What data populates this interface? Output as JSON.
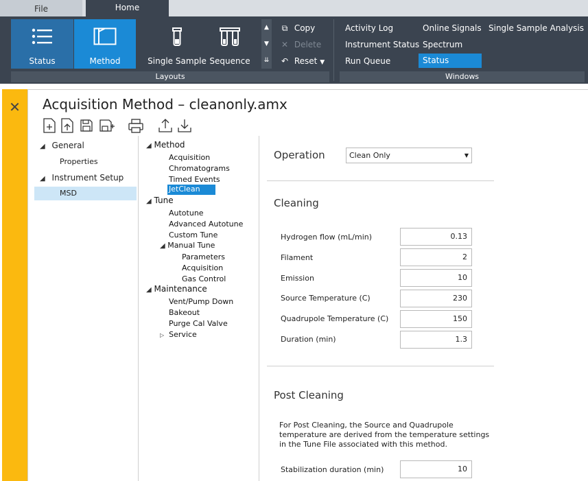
{
  "tabs": {
    "file": "File",
    "home": "Home"
  },
  "ribbon": {
    "status": "Status",
    "method": "Method",
    "single_sample": "Single Sample",
    "sequence": "Sequence",
    "copy": "Copy",
    "delete": "Delete",
    "reset": "Reset",
    "group_layouts": "Layouts",
    "group_windows": "Windows",
    "windows": {
      "activity_log": "Activity Log",
      "instrument_status": "Instrument Status",
      "run_queue": "Run Queue",
      "online_signals": "Online Signals",
      "spectrum": "Spectrum",
      "status": "Status",
      "single_sample_analysis": "Single Sample Analysis"
    }
  },
  "page": {
    "title": "Acquisition Method – cleanonly.amx"
  },
  "nav": {
    "general": "General",
    "properties": "Properties",
    "instrument_setup": "Instrument Setup",
    "msd": "MSD"
  },
  "tree": {
    "method": "Method",
    "acquisition": "Acquisition",
    "chromatograms": "Chromatograms",
    "timed_events": "Timed Events",
    "jetclean": "JetClean",
    "tune": "Tune",
    "autotune": "Autotune",
    "advanced_autotune": "Advanced Autotune",
    "custom_tune": "Custom Tune",
    "manual_tune": "Manual Tune",
    "parameters": "Parameters",
    "mt_acquisition": "Acquisition",
    "gas_control": "Gas Control",
    "maintenance": "Maintenance",
    "vent_pump_down": "Vent/Pump Down",
    "bakeout": "Bakeout",
    "purge_cal_valve": "Purge Cal Valve",
    "service": "Service"
  },
  "form": {
    "operation_label": "Operation",
    "operation_value": "Clean Only",
    "cleaning_heading": "Cleaning",
    "fields": {
      "hydrogen_flow": {
        "label": "Hydrogen flow (mL/min)",
        "value": "0.13"
      },
      "filament": {
        "label": "Filament",
        "value": "2"
      },
      "emission": {
        "label": "Emission",
        "value": "10"
      },
      "source_temp": {
        "label": "Source Temperature (C)",
        "value": "230"
      },
      "quad_temp": {
        "label": "Quadrupole Temperature (C)",
        "value": "150"
      },
      "duration": {
        "label": "Duration (min)",
        "value": "1.3"
      }
    },
    "post_cleaning_heading": "Post Cleaning",
    "post_cleaning_note": "For Post Cleaning, the Source and Quadrupole temperature are derived from the temperature settings in the Tune File associated with this method.",
    "stabilization": {
      "label": "Stabilization duration (min)",
      "value": "10"
    }
  }
}
